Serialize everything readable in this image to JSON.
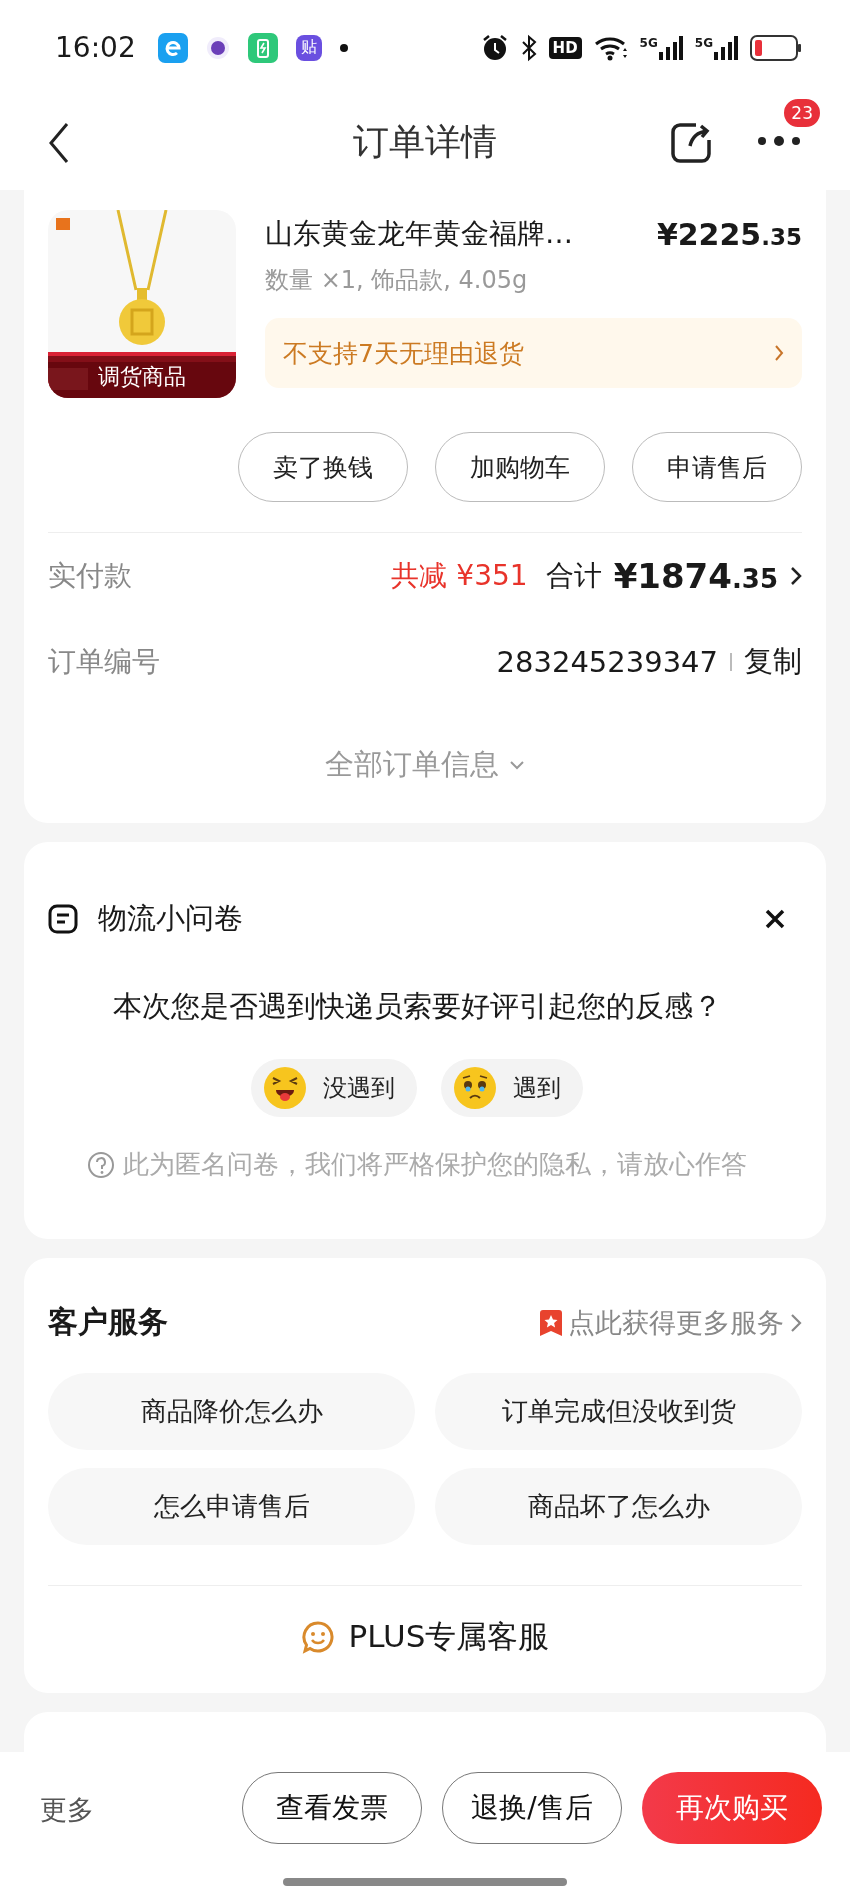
{
  "status_bar": {
    "time": "16:02",
    "notification_icons": [
      {
        "kind": "browser"
      },
      {
        "kind": "dot-app"
      },
      {
        "kind": "charge"
      },
      {
        "kind": "glyph",
        "glyph": "贴"
      }
    ],
    "hd_label": "HD",
    "network_labels": [
      "5G",
      "5G"
    ]
  },
  "header": {
    "title": "订单详情",
    "badge": "23"
  },
  "product": {
    "title": "山东黄金龙年黄金福牌…",
    "price_main": "¥2225",
    "price_decimal": ".35",
    "specs": "数量 ×1, 饰品款, 4.05g",
    "image_label": "调货商品",
    "notice": "不支持7天无理由退货",
    "actions": [
      "卖了换钱",
      "加购物车",
      "申请售后"
    ]
  },
  "payment": {
    "label": "实付款",
    "discount": "共减 ¥351",
    "total_label": "合计",
    "total_main": "¥1874",
    "total_decimal": ".35"
  },
  "order_number": {
    "label": "订单编号",
    "value": "283245239347",
    "copy": "复制"
  },
  "expand_label": "全部订单信息",
  "survey": {
    "title": "物流小问卷",
    "question": "本次您是否遇到快递员索要好评引起您的反感？",
    "options": [
      {
        "kind": "laugh",
        "label": "没遇到"
      },
      {
        "kind": "sad",
        "label": "遇到"
      }
    ],
    "note": "此为匿名问卷，我们将严格保护您的隐私，请放心作答"
  },
  "service": {
    "title": "客户服务",
    "more": "点此获得更多服务",
    "questions": [
      "商品降价怎么办",
      "订单完成但没收到货",
      "怎么申请售后",
      "商品坏了怎么办"
    ],
    "plus": "PLUS专属客服"
  },
  "bottom_bar": {
    "more": "更多",
    "buttons": [
      {
        "label": "查看发票",
        "kind": "outline"
      },
      {
        "label": "退换/售后",
        "kind": "outline"
      },
      {
        "label": "再次购买",
        "kind": "primary"
      }
    ]
  }
}
